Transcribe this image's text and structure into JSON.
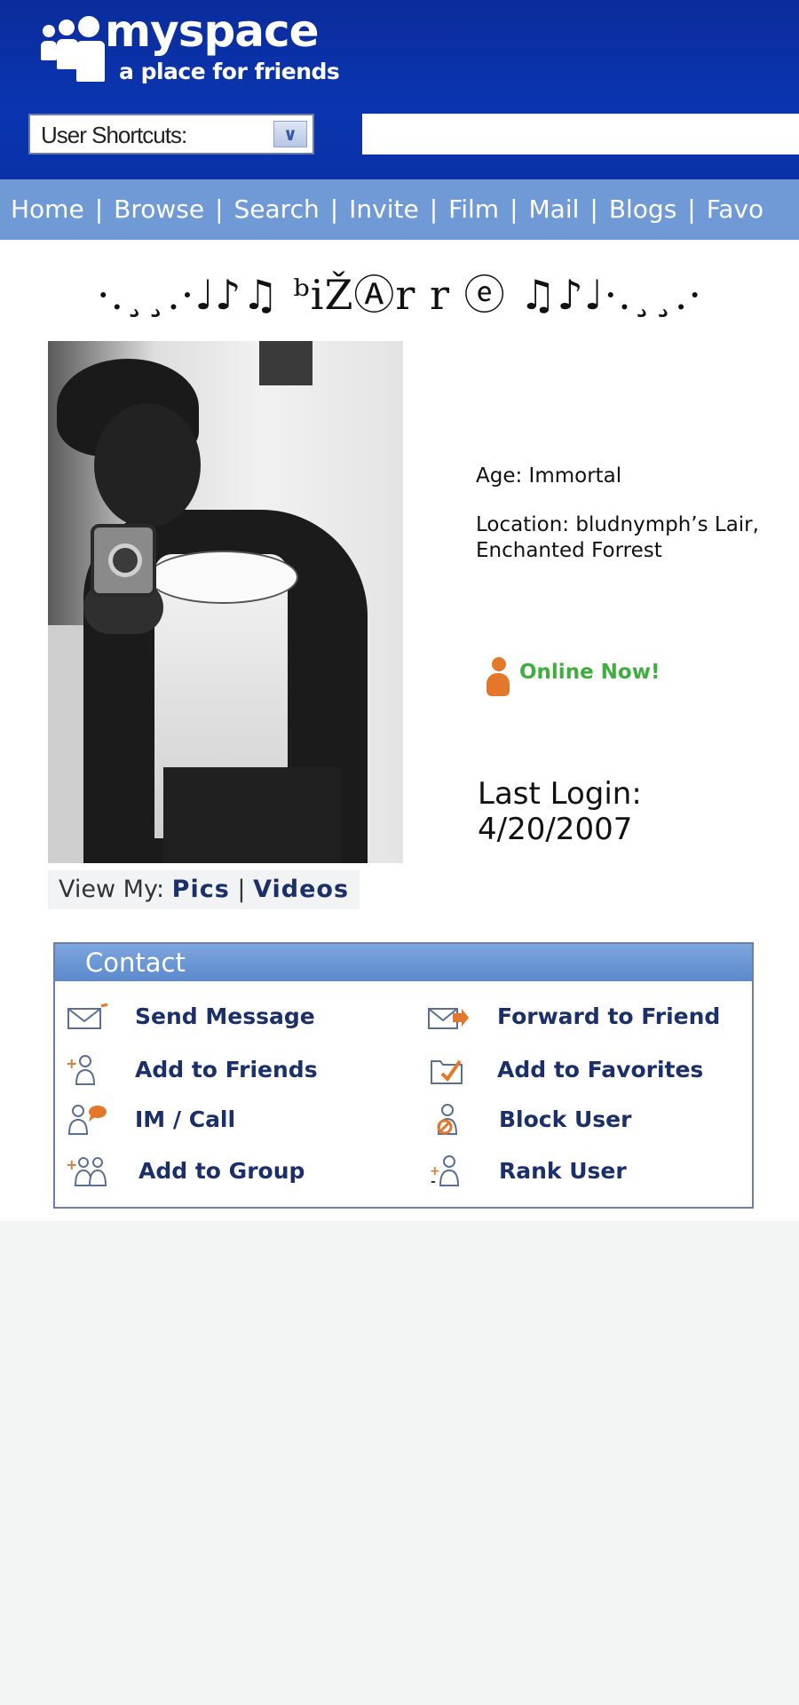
{
  "header": {
    "logo_name": "myspace",
    "logo_tagline": "a place for friends",
    "shortcuts_label": "User Shortcuts:",
    "search_value": ""
  },
  "nav": {
    "items": [
      "Home",
      "Browse",
      "Search",
      "Invite",
      "Film",
      "Mail",
      "Blogs",
      "Favo"
    ],
    "separator": "|"
  },
  "profile": {
    "title": "·.¸¸.·♩♪♫ ᵇiŽⒶr r ⓔ ♫♪♩·.¸¸.·",
    "age": "Age: Immortal",
    "location": "Location: bludnymph’s Lair, Enchanted Forrest",
    "online_status": "Online Now!",
    "last_login_label": "Last Login:",
    "last_login_date": "4/20/2007",
    "view_my_prefix": "View My:",
    "view_pics": "Pics",
    "view_sep": "|",
    "view_videos": "Videos"
  },
  "contact": {
    "title": "Contact",
    "items": [
      {
        "label": "Send Message",
        "icon": "envelope-icon"
      },
      {
        "label": "Forward to Friend",
        "icon": "envelope-forward-icon"
      },
      {
        "label": "Add to Friends",
        "icon": "add-friend-icon"
      },
      {
        "label": "Add to Favorites",
        "icon": "favorites-icon"
      },
      {
        "label": "IM / Call",
        "icon": "im-call-icon"
      },
      {
        "label": "Block User",
        "icon": "block-user-icon"
      },
      {
        "label": "Add to Group",
        "icon": "add-group-icon"
      },
      {
        "label": "Rank User",
        "icon": "rank-user-icon"
      }
    ]
  },
  "colors": {
    "header_blue": "#0a35b1",
    "nav_blue": "#6f9ad6",
    "link_navy": "#1b2f6b",
    "online_green": "#3fae3f",
    "accent_orange": "#e4782a"
  }
}
